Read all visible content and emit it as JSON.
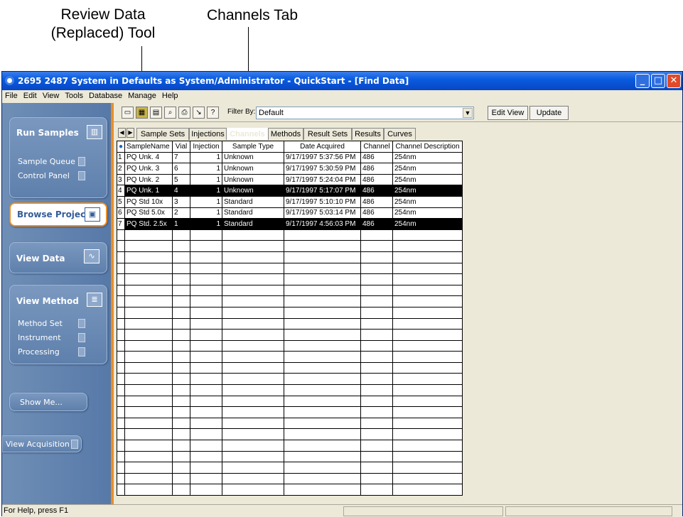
{
  "annotations": {
    "review_tool_line1": "Review Data",
    "review_tool_line2": "(Replaced) Tool",
    "channels_tab": "Channels Tab"
  },
  "window": {
    "title": "2695 2487 System in Defaults as System/Administrator - QuickStart - [Find Data]"
  },
  "menu": [
    "File",
    "Edit",
    "View",
    "Tools",
    "Database",
    "Manage",
    "Help"
  ],
  "sidebar": {
    "run_samples": {
      "title": "Run Samples",
      "items": [
        "Sample Queue",
        "Control Panel"
      ]
    },
    "browse_project": {
      "title": "Browse Project"
    },
    "view_data": {
      "title": "View Data"
    },
    "view_method": {
      "title": "View Method",
      "items": [
        "Method Set",
        "Instrument",
        "Processing"
      ]
    },
    "show_me": "Show Me...",
    "view_acquisition": "View Acquisition"
  },
  "toolbar": {
    "filter_label": "Filter By:",
    "filter_value": "Default",
    "edit_view": "Edit View",
    "update": "Update"
  },
  "tabs": [
    "Sample Sets",
    "Injections",
    "Channels",
    "Methods",
    "Result Sets",
    "Results",
    "Curves"
  ],
  "active_tab": "Channels",
  "table": {
    "columns": [
      "SampleName",
      "Vial",
      "Injection",
      "Sample Type",
      "Date Acquired",
      "Channel",
      "Channel Description"
    ],
    "rows": [
      [
        "1",
        "PQ Unk. 4",
        "7",
        "1",
        "Unknown",
        "9/17/1997 5:37:56 PM",
        "486",
        "254nm"
      ],
      [
        "2",
        "PQ Unk. 3",
        "6",
        "1",
        "Unknown",
        "9/17/1997 5:30:59 PM",
        "486",
        "254nm"
      ],
      [
        "3",
        "PQ Unk. 2",
        "5",
        "1",
        "Unknown",
        "9/17/1997 5:24:04 PM",
        "486",
        "254nm"
      ],
      [
        "4",
        "PQ Unk. 1",
        "4",
        "1",
        "Unknown",
        "9/17/1997 5:17:07 PM",
        "486",
        "254nm"
      ],
      [
        "5",
        "PQ Std 10x",
        "3",
        "1",
        "Standard",
        "9/17/1997 5:10:10 PM",
        "486",
        "254nm"
      ],
      [
        "6",
        "PQ Std 5.0x",
        "2",
        "1",
        "Standard",
        "9/17/1997 5:03:14 PM",
        "486",
        "254nm"
      ],
      [
        "7",
        "PQ Std. 2.5x",
        "1",
        "1",
        "Standard",
        "9/17/1997 4:56:03 PM",
        "486",
        "254nm"
      ]
    ],
    "selected_rows": [
      4,
      7
    ]
  },
  "status": {
    "text": "For Help, press F1"
  },
  "colors": {
    "title_blue": "#0a5ce0",
    "sidebar_blue": "#5779a8",
    "accent_orange": "#e88e2a"
  }
}
